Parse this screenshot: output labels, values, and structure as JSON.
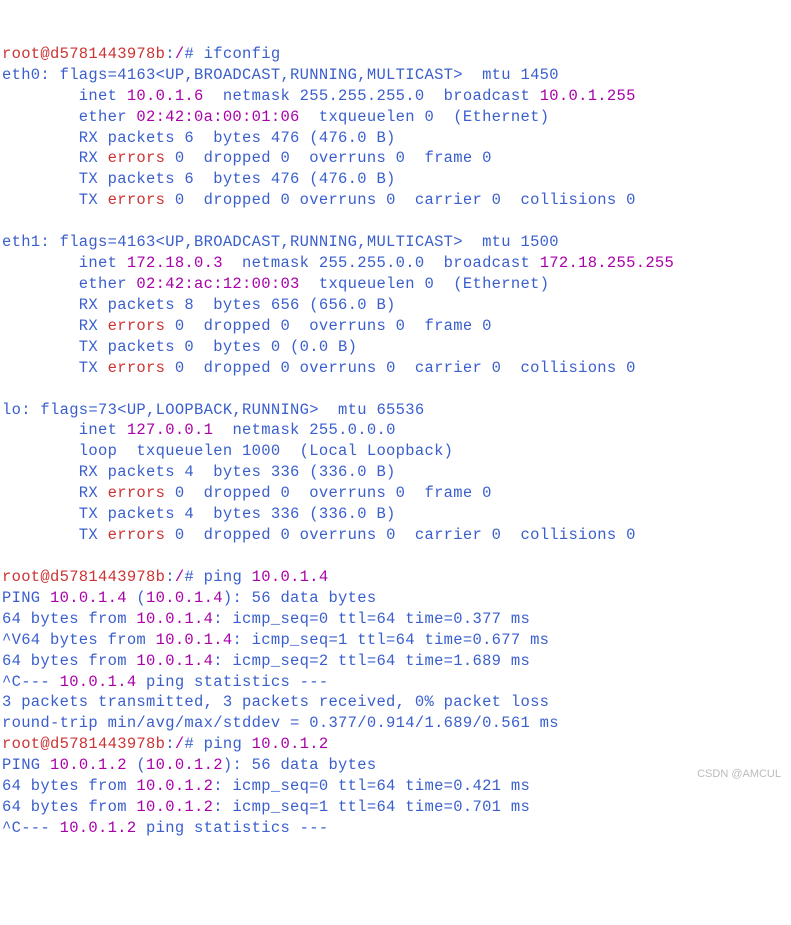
{
  "p1": "root@d5781443978b",
  "p2": ":",
  "p3": "/",
  "p4": "# ",
  "cmd1": "ifconfig",
  "eth0_l1": "eth0: flags=4163<UP,BROADCAST,RUNNING,MULTICAST>  mtu 1450",
  "eth0_l2a": "        inet ",
  "eth0_l2b": "10.0.1.6",
  "eth0_l2c": "  netmask 255.255.255.0  broadcast ",
  "eth0_l2d": "10.0.1.255",
  "eth0_l3a": "        ether ",
  "eth0_l3b": "02:42:0a:00:01:06",
  "eth0_l3c": "  txqueuelen 0  (Ethernet)",
  "eth0_l4": "        RX packets 6  bytes 476 (476.0 B)",
  "eth0_l5a": "        RX ",
  "eth0_l5b": "errors",
  "eth0_l5c": " 0  dropped 0  overruns 0  frame 0",
  "eth0_l6": "        TX packets 6  bytes 476 (476.0 B)",
  "eth0_l7a": "        TX ",
  "eth0_l7b": "errors",
  "eth0_l7c": " 0  dropped 0 overruns 0  carrier 0  collisions 0",
  "eth1_l1": "eth1: flags=4163<UP,BROADCAST,RUNNING,MULTICAST>  mtu 1500",
  "eth1_l2a": "        inet ",
  "eth1_l2b": "172.18.0.3",
  "eth1_l2c": "  netmask 255.255.0.0  broadcast ",
  "eth1_l2d": "172.18.255.255",
  "eth1_l3a": "        ether ",
  "eth1_l3b": "02:42:ac:12:00:03",
  "eth1_l3c": "  txqueuelen 0  (Ethernet)",
  "eth1_l4": "        RX packets 8  bytes 656 (656.0 B)",
  "eth1_l5a": "        RX ",
  "eth1_l5b": "errors",
  "eth1_l5c": " 0  dropped 0  overruns 0  frame 0",
  "eth1_l6": "        TX packets 0  bytes 0 (0.0 B)",
  "eth1_l7a": "        TX ",
  "eth1_l7b": "errors",
  "eth1_l7c": " 0  dropped 0 overruns 0  carrier 0  collisions 0",
  "lo_l1": "lo: flags=73<UP,LOOPBACK,RUNNING>  mtu 65536",
  "lo_l2a": "        inet ",
  "lo_l2b": "127.0.0.1",
  "lo_l2c": "  netmask 255.0.0.0",
  "lo_l3": "        loop  txqueuelen 1000  (Local Loopback)",
  "lo_l4": "        RX packets 4  bytes 336 (336.0 B)",
  "lo_l5a": "        RX ",
  "lo_l5b": "errors",
  "lo_l5c": " 0  dropped 0  overruns 0  frame 0",
  "lo_l6": "        TX packets 4  bytes 336 (336.0 B)",
  "lo_l7a": "        TX ",
  "lo_l7b": "errors",
  "lo_l7c": " 0  dropped 0 overruns 0  carrier 0  collisions 0",
  "cmd2a": "ping ",
  "cmd2b": "10.0.1.4",
  "ping1_l1a": "PING ",
  "ping1_l1b": "10.0.1.4",
  "ping1_l1c": " (",
  "ping1_l1d": "10.0.1.4",
  "ping1_l1e": "): 56 data bytes",
  "ping1_l2a": "64 bytes from ",
  "ping1_l2b": "10.0.1.4",
  "ping1_l2c": ": icmp_seq=0 ttl=64 time=0.377 ms",
  "ping1_l3a": "^V64 bytes from ",
  "ping1_l3b": "10.0.1.4",
  "ping1_l3c": ": icmp_seq=1 ttl=64 time=0.677 ms",
  "ping1_l4a": "64 bytes from ",
  "ping1_l4b": "10.0.1.4",
  "ping1_l4c": ": icmp_seq=2 ttl=64 time=1.689 ms",
  "ping1_l5a": "^C--- ",
  "ping1_l5b": "10.0.1.4",
  "ping1_l5c": " ping statistics ---",
  "ping1_l6": "3 packets transmitted, 3 packets received, 0% packet loss",
  "ping1_l7": "round-trip min/avg/max/stddev = 0.377/0.914/1.689/0.561 ms",
  "cmd3a": "ping ",
  "cmd3b": "10.0.1.2",
  "ping2_l1a": "PING ",
  "ping2_l1b": "10.0.1.2",
  "ping2_l1c": " (",
  "ping2_l1d": "10.0.1.2",
  "ping2_l1e": "): 56 data bytes",
  "ping2_l2a": "64 bytes from ",
  "ping2_l2b": "10.0.1.2",
  "ping2_l2c": ": icmp_seq=0 ttl=64 time=0.421 ms",
  "ping2_l3a": "64 bytes from ",
  "ping2_l3b": "10.0.1.2",
  "ping2_l3c": ": icmp_seq=1 ttl=64 time=0.701 ms",
  "ping2_l4a": "^C--- ",
  "ping2_l4b": "10.0.1.2",
  "ping2_l4c": " ping statistics ---",
  "wm": "CSDN @AMCUL"
}
